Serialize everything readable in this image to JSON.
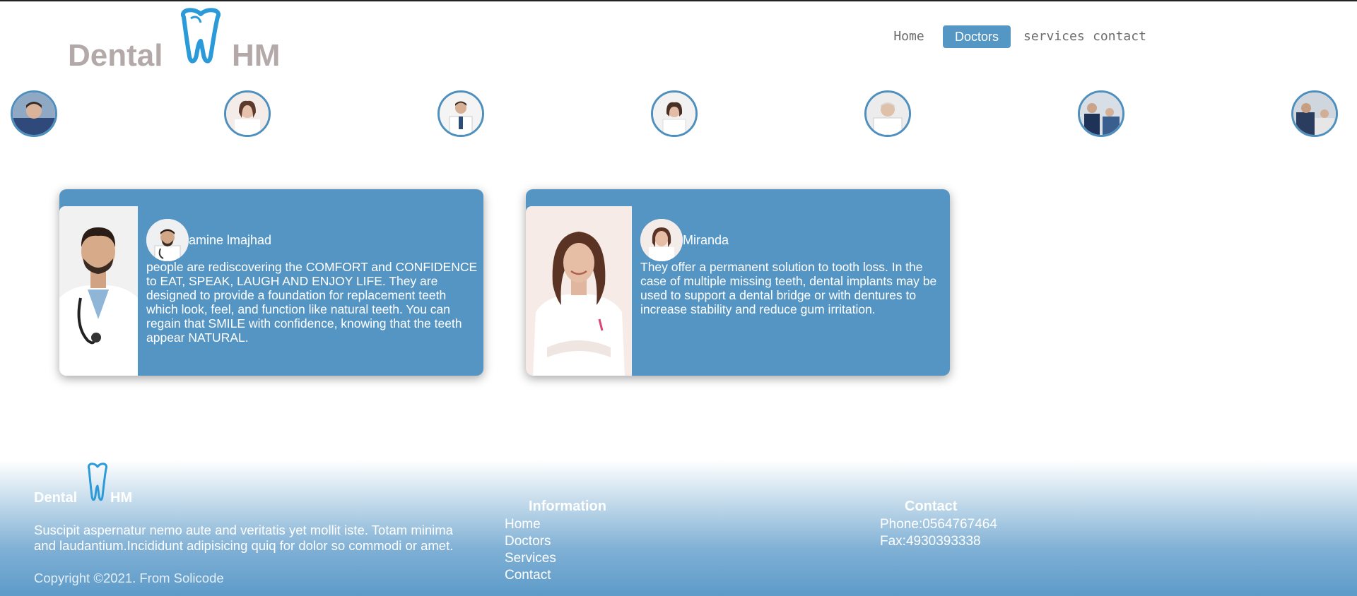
{
  "header": {
    "logo": {
      "word1": "Dental",
      "word2": "HM"
    },
    "nav": [
      {
        "label": "Home",
        "active": false
      },
      {
        "label": "Doctors",
        "active": true
      },
      {
        "label": "services",
        "active": false
      },
      {
        "label": "contact",
        "active": false
      }
    ]
  },
  "colors": {
    "accent": "#5497c4",
    "card_bg": "#5595c3",
    "logo_gray": "#b4a9a9",
    "tooth_blue": "#2a9ad8"
  },
  "avatar_icons": [
    "doctor-portrait-icon",
    "doctor-portrait-icon",
    "doctor-portrait-icon",
    "doctor-portrait-icon",
    "doctor-portrait-icon",
    "doctor-portrait-icon",
    "doctor-portrait-icon"
  ],
  "cards": [
    {
      "name": "amine lmajhad",
      "text": "people are rediscovering the COMFORT and CONFIDENCE to EAT, SPEAK, LAUGH AND ENJOY LIFE. They are designed to provide a foundation for replacement teeth which look, feel, and function like natural teeth. You can regain that SMILE with confidence, knowing that the teeth appear NATURAL."
    },
    {
      "name": "Miranda",
      "text": "They offer a permanent solution to tooth loss. In the case of multiple missing teeth, dental implants may be used to support a dental bridge or with dentures to increase stability and reduce gum irritation."
    }
  ],
  "footer": {
    "logo": {
      "word1": "Dental",
      "word2": "HM"
    },
    "about": "Suscipit aspernatur nemo aute and veritatis yet mollit iste. Totam minima and laudantium.Incididunt adipisicing quiq for dolor so commodi or amet.",
    "copyright": "Copyright ©2021. From Solicode",
    "information": {
      "heading": "Information",
      "links": [
        "Home",
        "Doctors",
        "Services",
        "Contact"
      ]
    },
    "contact": {
      "heading": "Contact",
      "phone": "Phone:0564767464",
      "fax": "Fax:4930393338"
    }
  }
}
